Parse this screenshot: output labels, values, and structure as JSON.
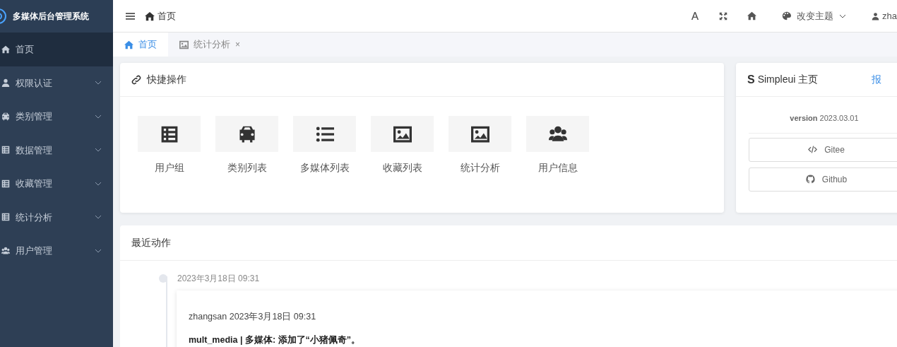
{
  "sidebar": {
    "title": "多媒体后台管理系统",
    "items": [
      {
        "label": "首页",
        "kind": "link",
        "selected": true
      },
      {
        "label": "权限认证",
        "kind": "group",
        "selected": false
      },
      {
        "label": "类别管理",
        "kind": "group",
        "selected": false
      },
      {
        "label": "数据管理",
        "kind": "group",
        "selected": false
      },
      {
        "label": "收藏管理",
        "kind": "group",
        "selected": false
      },
      {
        "label": "统计分析",
        "kind": "group",
        "selected": false
      },
      {
        "label": "用户管理",
        "kind": "group",
        "selected": false
      }
    ]
  },
  "header": {
    "breadcrumb": "首页",
    "theme_label": "改变主题",
    "user": "zha"
  },
  "tabs": [
    {
      "label": "首页",
      "selected": true,
      "closable": false
    },
    {
      "label": "统计分析",
      "selected": false,
      "closable": true,
      "close": "×"
    }
  ],
  "quick_actions": {
    "title": "快捷操作",
    "items": [
      {
        "label": "用户组"
      },
      {
        "label": "类别列表"
      },
      {
        "label": "多媒体列表"
      },
      {
        "label": "收藏列表"
      },
      {
        "label": "统计分析"
      },
      {
        "label": "用户信息"
      }
    ]
  },
  "simpleui": {
    "title": "Simpleui 主页",
    "logo": "S",
    "link": "报",
    "version": "**version** 2023.03.01",
    "buttons": [
      {
        "label": "Gitee"
      },
      {
        "label": "Github"
      }
    ]
  },
  "recent": {
    "title": "最近动作",
    "entries": [
      {
        "time": "2023年3月18日 09:31",
        "author_line": "zhangsan 2023年3月18日 09:31",
        "message": "mult_media | 多媒体: 添加了“小猪佩奇”。"
      }
    ]
  }
}
